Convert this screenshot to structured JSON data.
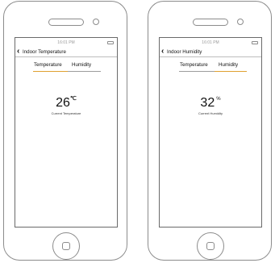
{
  "phones": [
    {
      "status_time": "16:01 PM",
      "header_title": "Indoor Temperature",
      "tabs": [
        {
          "label": "Temperature",
          "active": true
        },
        {
          "label": "Humidity",
          "active": false
        }
      ],
      "reading": {
        "value": "26",
        "unit": "℃",
        "caption": "Current Temperature"
      }
    },
    {
      "status_time": "16:01 PM",
      "header_title": "Indoor Humidity",
      "tabs": [
        {
          "label": "Temperature",
          "active": false
        },
        {
          "label": "Humidity",
          "active": true
        }
      ],
      "reading": {
        "value": "32",
        "unit": "%",
        "caption": "Current Humidity"
      }
    }
  ],
  "colors": {
    "active_tab_underline": "#e0a030",
    "inactive_tab_underline": "#9c9c9c",
    "frame": "#8c8c8c"
  },
  "icons": {
    "back": "chevron-left-icon",
    "battery": "battery-icon",
    "home": "home-button-icon"
  }
}
